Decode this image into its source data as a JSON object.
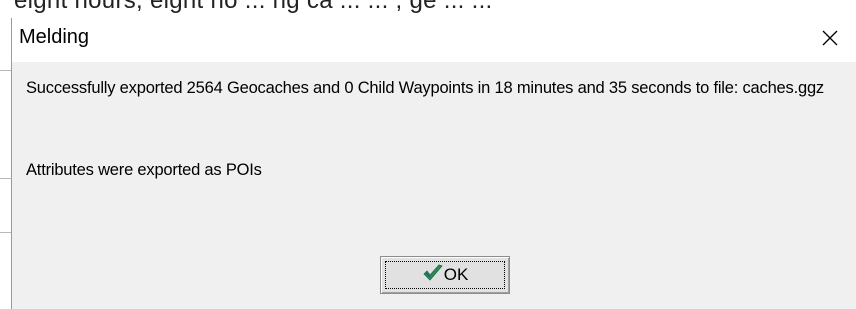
{
  "background": {
    "partial_text": "eight hours, eight ho ... ng ca ... ... , ge ... ..."
  },
  "dialog": {
    "title": "Melding",
    "close_icon": "close-icon",
    "message_line1": "Successfully exported 2564 Geocaches and 0 Child Waypoints in 18 minutes and 35 seconds to file: caches.ggz",
    "message_line2": "Attributes were exported as POIs",
    "ok_button": {
      "label": "OK",
      "icon": "checkmark-icon"
    }
  },
  "colors": {
    "dialog_background": "#f0f0f0",
    "titlebar_background": "#ffffff",
    "checkmark": "#2e8b57",
    "checkmark_accent": "#1a4fbf"
  }
}
